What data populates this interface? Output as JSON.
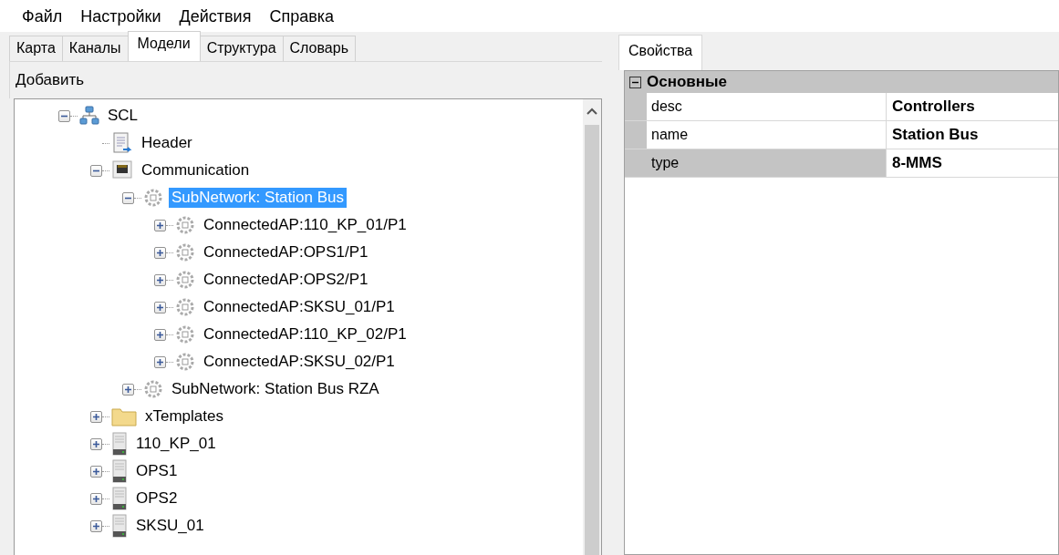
{
  "menu": [
    "Файл",
    "Настройки",
    "Действия",
    "Справка"
  ],
  "tabs": [
    {
      "label": "Карта",
      "selected": false
    },
    {
      "label": "Каналы",
      "selected": false
    },
    {
      "label": "Модели",
      "selected": true
    },
    {
      "label": "Структура",
      "selected": false
    },
    {
      "label": "Словарь",
      "selected": false
    }
  ],
  "toolbar": {
    "add_button": "Добавить"
  },
  "tree": [
    {
      "label": "SCL",
      "kind": "network",
      "expanded": true,
      "selected": false,
      "children": [
        {
          "label": "Header",
          "kind": "document",
          "selected": false
        },
        {
          "label": "Communication",
          "kind": "port",
          "expanded": true,
          "selected": false,
          "children": [
            {
              "label": "SubNetwork: Station Bus",
              "kind": "subnet",
              "expanded": true,
              "selected": true,
              "children": [
                {
                  "label": "ConnectedAP:110_KP_01/P1",
                  "kind": "subnet",
                  "expanded": false,
                  "selected": false
                },
                {
                  "label": "ConnectedAP:OPS1/P1",
                  "kind": "subnet",
                  "expanded": false,
                  "selected": false
                },
                {
                  "label": "ConnectedAP:OPS2/P1",
                  "kind": "subnet",
                  "expanded": false,
                  "selected": false
                },
                {
                  "label": "ConnectedAP:SKSU_01/P1",
                  "kind": "subnet",
                  "expanded": false,
                  "selected": false
                },
                {
                  "label": "ConnectedAP:110_KP_02/P1",
                  "kind": "subnet",
                  "expanded": false,
                  "selected": false
                },
                {
                  "label": "ConnectedAP:SKSU_02/P1",
                  "kind": "subnet",
                  "expanded": false,
                  "selected": false
                }
              ]
            },
            {
              "label": "SubNetwork: Station Bus RZA",
              "kind": "subnet",
              "expanded": false,
              "selected": false
            }
          ]
        },
        {
          "label": "xTemplates",
          "kind": "folder",
          "expanded": false,
          "selected": false
        },
        {
          "label": "110_KP_01",
          "kind": "server",
          "expanded": false,
          "selected": false
        },
        {
          "label": "OPS1",
          "kind": "server",
          "expanded": false,
          "selected": false
        },
        {
          "label": "OPS2",
          "kind": "server",
          "expanded": false,
          "selected": false
        },
        {
          "label": "SKSU_01",
          "kind": "server",
          "expanded": false,
          "selected": false
        }
      ]
    }
  ],
  "properties": {
    "tab": "Свойства",
    "category": {
      "label": "Основные",
      "expanded": true
    },
    "rows": [
      {
        "name": "desc",
        "value": "Controllers",
        "selected": false
      },
      {
        "name": "name",
        "value": "Station Bus",
        "selected": false
      },
      {
        "name": "type",
        "value": "8-MMS",
        "selected": true
      }
    ]
  }
}
